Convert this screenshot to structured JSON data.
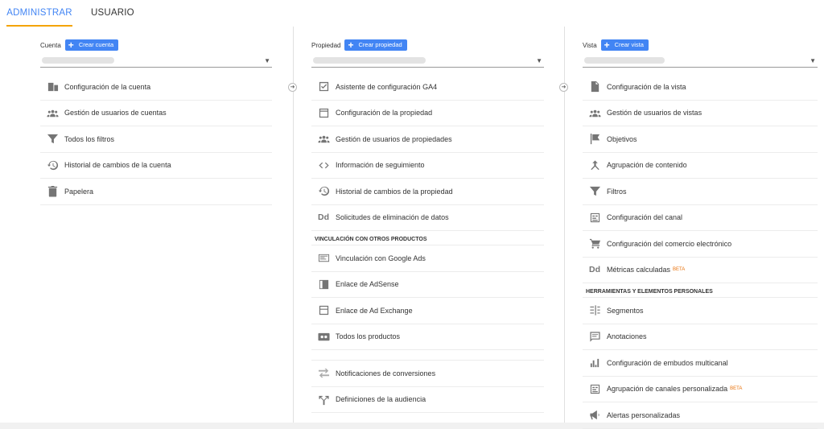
{
  "tabs": {
    "admin": "ADMINISTRAR",
    "user": "USUARIO"
  },
  "account": {
    "label": "Cuenta",
    "create": "Crear cuenta",
    "items": [
      {
        "label": "Configuración de la cuenta",
        "icon": "building-icon"
      },
      {
        "label": "Gestión de usuarios de cuentas",
        "icon": "people-icon"
      },
      {
        "label": "Todos los filtros",
        "icon": "filter-icon"
      },
      {
        "label": "Historial de cambios de la cuenta",
        "icon": "history-icon"
      },
      {
        "label": "Papelera",
        "icon": "trash-icon"
      }
    ]
  },
  "property": {
    "label": "Propiedad",
    "create": "Crear propiedad",
    "items": [
      {
        "label": "Asistente de configuración GA4",
        "icon": "checkbox-icon"
      },
      {
        "label": "Configuración de la propiedad",
        "icon": "layout-icon"
      },
      {
        "label": "Gestión de usuarios de propiedades",
        "icon": "people-icon"
      },
      {
        "label": "Información de seguimiento",
        "icon": "code-icon"
      },
      {
        "label": "Historial de cambios de la propiedad",
        "icon": "history-icon"
      },
      {
        "label": "Solicitudes de eliminación de datos",
        "icon": "dd-icon"
      }
    ],
    "section": "VINCULACIÓN CON OTROS PRODUCTOS",
    "linked": [
      {
        "label": "Vinculación con Google Ads",
        "icon": "ads-icon"
      },
      {
        "label": "Enlace de AdSense",
        "icon": "adsense-icon"
      },
      {
        "label": "Enlace de Ad Exchange",
        "icon": "adexchange-icon"
      },
      {
        "label": "Todos los productos",
        "icon": "products-icon"
      }
    ],
    "extra": [
      {
        "label": "Notificaciones de conversiones",
        "icon": "conversions-icon"
      },
      {
        "label": "Definiciones de la audiencia",
        "icon": "audience-icon"
      }
    ]
  },
  "view": {
    "label": "Vista",
    "create": "Crear vista",
    "items": [
      {
        "label": "Configuración de la vista",
        "icon": "document-icon"
      },
      {
        "label": "Gestión de usuarios de vistas",
        "icon": "people-icon"
      },
      {
        "label": "Objetivos",
        "icon": "flag-icon"
      },
      {
        "label": "Agrupación de contenido",
        "icon": "content-group-icon"
      },
      {
        "label": "Filtros",
        "icon": "filter-icon"
      },
      {
        "label": "Configuración del canal",
        "icon": "channel-icon"
      },
      {
        "label": "Configuración del comercio electrónico",
        "icon": "cart-icon"
      },
      {
        "label": "Métricas calculadas",
        "icon": "dd-icon",
        "badge": "BETA"
      }
    ],
    "section": "HERRAMIENTAS Y ELEMENTOS PERSONALES",
    "tools": [
      {
        "label": "Segmentos",
        "icon": "segments-icon"
      },
      {
        "label": "Anotaciones",
        "icon": "comment-icon"
      },
      {
        "label": "Configuración de embudos multicanal",
        "icon": "bars-icon"
      },
      {
        "label": "Agrupación de canales personalizada",
        "icon": "channel-icon",
        "badge": "BETA"
      },
      {
        "label": "Alertas personalizadas",
        "icon": "megaphone-icon"
      }
    ]
  }
}
